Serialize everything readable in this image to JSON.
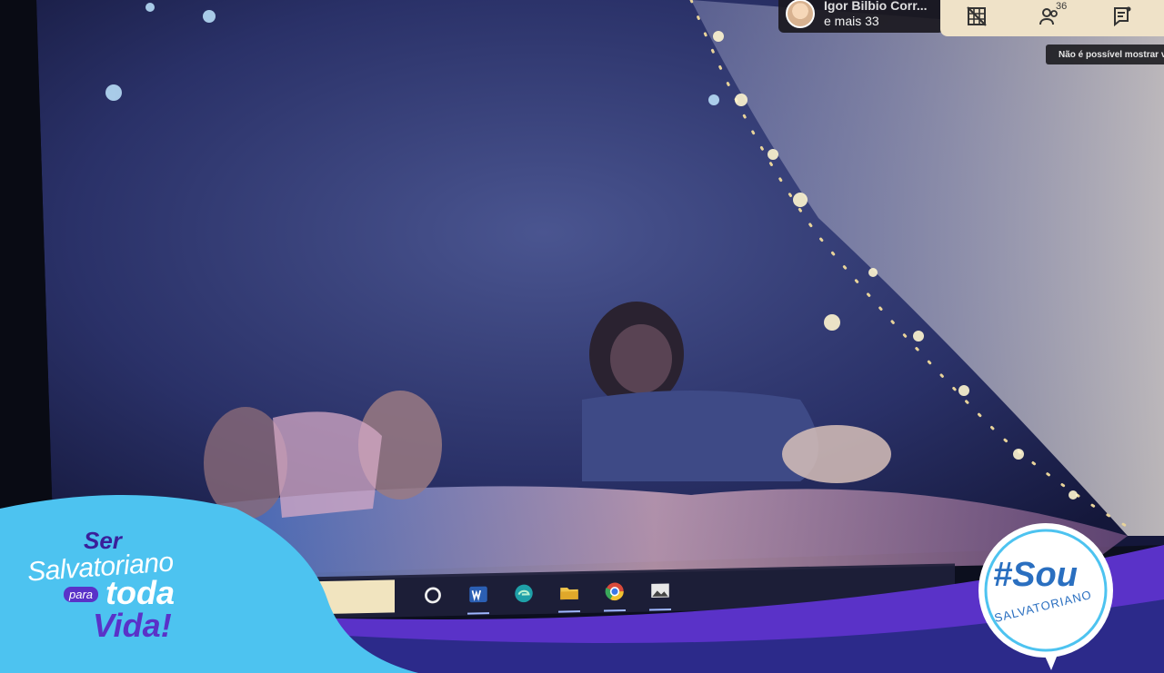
{
  "meeting": {
    "presenter_name": "Igor Bilbio Corr...",
    "participants_more": "e mais 33",
    "participants_count": "36",
    "notice_text": "Não é possível mostrar v"
  },
  "toolbar": {
    "grid_icon": "grid-off-icon",
    "people_icon": "people-icon",
    "chat_icon": "chat-icon"
  },
  "taskbar": {
    "icons": [
      "cortana-circle-icon",
      "word-icon",
      "edge-icon",
      "file-explorer-icon",
      "chrome-icon",
      "photos-icon"
    ]
  },
  "branding": {
    "left": {
      "ser": "Ser",
      "salvatoriano": "Salvatoriano",
      "para": "para",
      "toda": "toda",
      "vida": "Vida!"
    },
    "right": {
      "sou": "#Sou",
      "salvatoriano": "SALVATORIANO"
    }
  },
  "colors": {
    "toolbar_bg": "#efe2c8",
    "cyan_wave": "#4dc3f0",
    "purple_wave": "#5a32c8",
    "navy_wave": "#2c2a8a"
  }
}
